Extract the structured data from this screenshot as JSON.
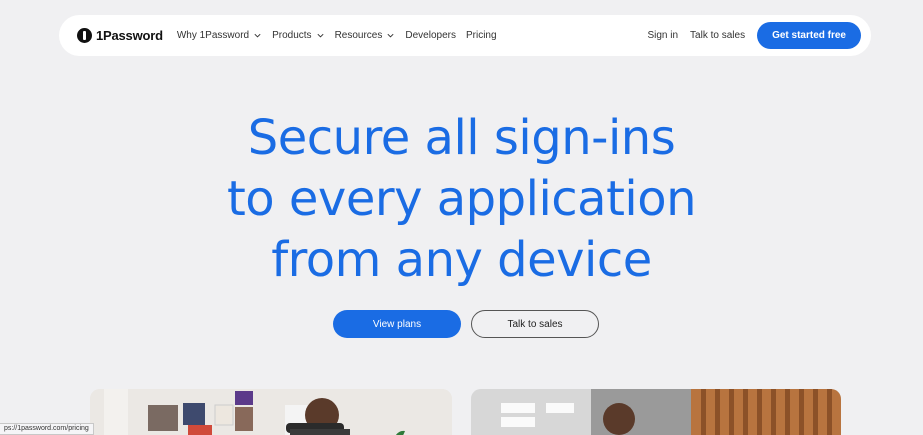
{
  "nav": {
    "brand": "1Password",
    "links": [
      {
        "label": "Why 1Password"
      },
      {
        "label": "Products"
      },
      {
        "label": "Resources"
      },
      {
        "label": "Developers"
      },
      {
        "label": "Pricing"
      }
    ],
    "sign_in": "Sign in",
    "talk_to_sales": "Talk to sales",
    "cta": "Get started free"
  },
  "hero": {
    "line1": "Secure all sign-ins",
    "line2": "to every application",
    "line3": "from any device"
  },
  "actions": {
    "primary": "View plans",
    "secondary": "Talk to sales"
  },
  "status_bar": {
    "url": "ps://1password.com/pricing"
  },
  "colors": {
    "accent": "#1a6ce4",
    "background": "#f0f0f2"
  }
}
